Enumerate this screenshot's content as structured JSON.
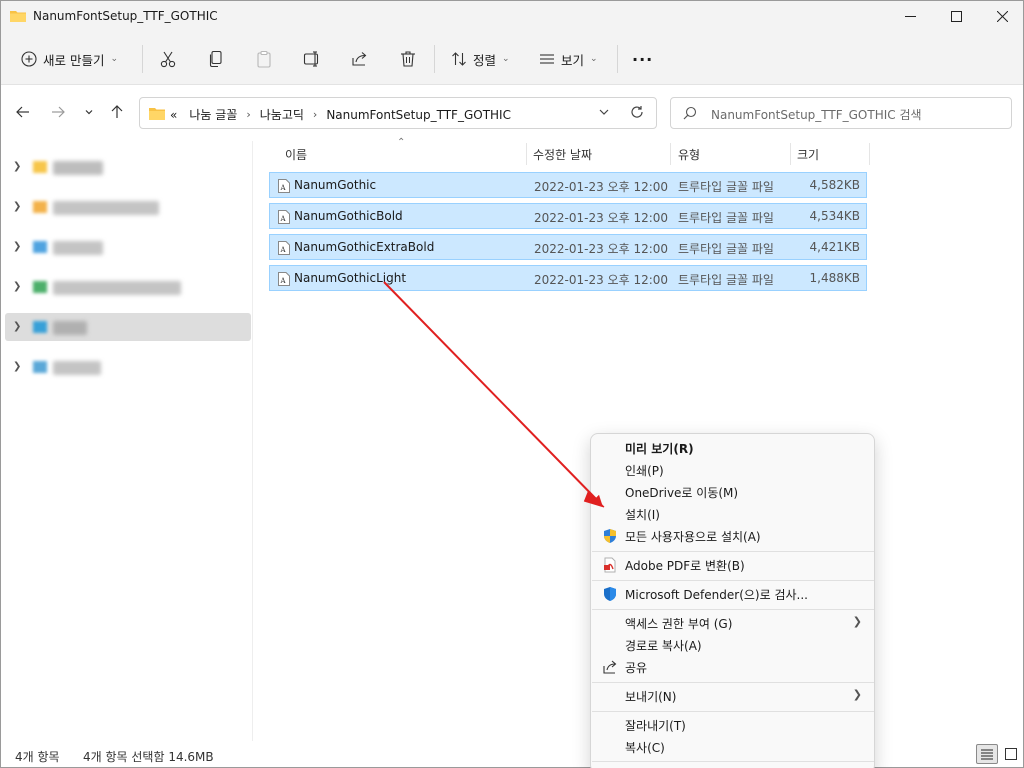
{
  "window": {
    "title": "NanumFontSetup_TTF_GOTHIC"
  },
  "toolbar": {
    "new_label": "새로 만들기",
    "sort_label": "정렬",
    "view_label": "보기",
    "more_label": "···"
  },
  "address": {
    "overflow": "«",
    "crumbs": [
      "나눔 글꼴",
      "나눔고딕",
      "NanumFontSetup_TTF_GOTHIC"
    ],
    "search_placeholder": "NanumFontSetup_TTF_GOTHIC 검색"
  },
  "columns": {
    "name": "이름",
    "date": "수정한 날짜",
    "type": "유형",
    "size": "크기"
  },
  "files": [
    {
      "name": "NanumGothic",
      "date": "2022-01-23 오후 12:00",
      "type": "트루타입 글꼴 파일",
      "size": "4,582KB"
    },
    {
      "name": "NanumGothicBold",
      "date": "2022-01-23 오후 12:00",
      "type": "트루타입 글꼴 파일",
      "size": "4,534KB"
    },
    {
      "name": "NanumGothicExtraBold",
      "date": "2022-01-23 오후 12:00",
      "type": "트루타입 글꼴 파일",
      "size": "4,421KB"
    },
    {
      "name": "NanumGothicLight",
      "date": "2022-01-23 오후 12:00",
      "type": "트루타입 글꼴 파일",
      "size": "1,488KB"
    }
  ],
  "status": {
    "count": "4개 항목",
    "selection": "4개 항목 선택함 14.6MB"
  },
  "context_menu": {
    "items": [
      {
        "label": "미리 보기(R)",
        "bold": true
      },
      {
        "label": "인쇄(P)"
      },
      {
        "label": "OneDrive로 이동(M)"
      },
      {
        "label": "설치(I)"
      },
      {
        "label": "모든 사용자용으로 설치(A)",
        "icon": "shield-icon"
      },
      {
        "label": "Adobe PDF로 변환(B)",
        "icon": "pdf-icon"
      },
      {
        "label": "Microsoft Defender(으)로 검사...",
        "icon": "defender-icon"
      },
      {
        "label": "액세스 권한 부여 (G)",
        "submenu": true
      },
      {
        "label": "경로로 복사(A)"
      },
      {
        "label": "공유",
        "icon": "share-icon"
      },
      {
        "label": "보내기(N)",
        "submenu": true
      },
      {
        "label": "잘라내기(T)"
      },
      {
        "label": "복사(C)"
      }
    ]
  },
  "colors": {
    "selection_bg": "#cce8ff",
    "selection_border": "#99d1ff",
    "annotation_arrow": "#e02020"
  }
}
